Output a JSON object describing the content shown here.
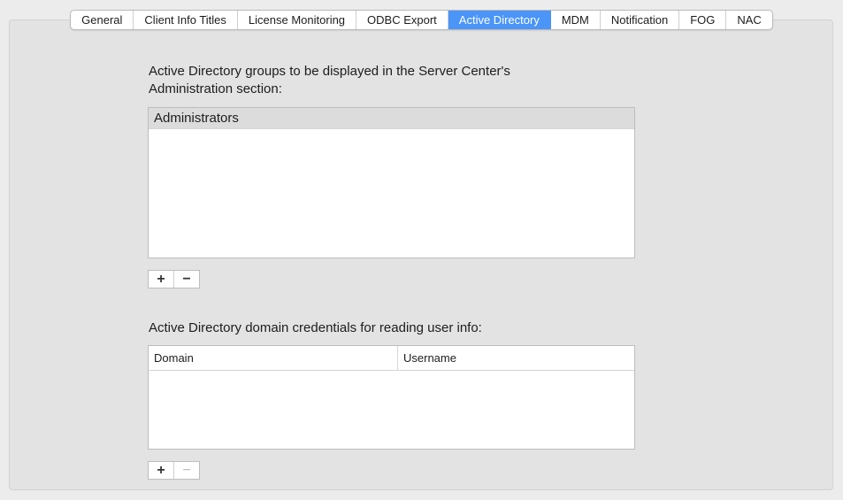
{
  "tabs": [
    {
      "label": "General",
      "active": false
    },
    {
      "label": "Client Info Titles",
      "active": false
    },
    {
      "label": "License Monitoring",
      "active": false
    },
    {
      "label": "ODBC Export",
      "active": false
    },
    {
      "label": "Active Directory",
      "active": true
    },
    {
      "label": "MDM",
      "active": false
    },
    {
      "label": "Notification",
      "active": false
    },
    {
      "label": "FOG",
      "active": false
    },
    {
      "label": "NAC",
      "active": false
    }
  ],
  "groups_section": {
    "label_line1": "Active Directory groups to be displayed in the Server Center's",
    "label_line2": "Administration section:",
    "items": [
      "Administrators"
    ],
    "add_button": "+",
    "remove_button": "−"
  },
  "credentials_section": {
    "label": "Active Directory domain credentials for reading user info:",
    "columns": [
      "Domain",
      "Username"
    ],
    "add_button": "+",
    "remove_button": "−"
  },
  "colors": {
    "accent": "#4a95f7",
    "background": "#e3e3e3"
  }
}
